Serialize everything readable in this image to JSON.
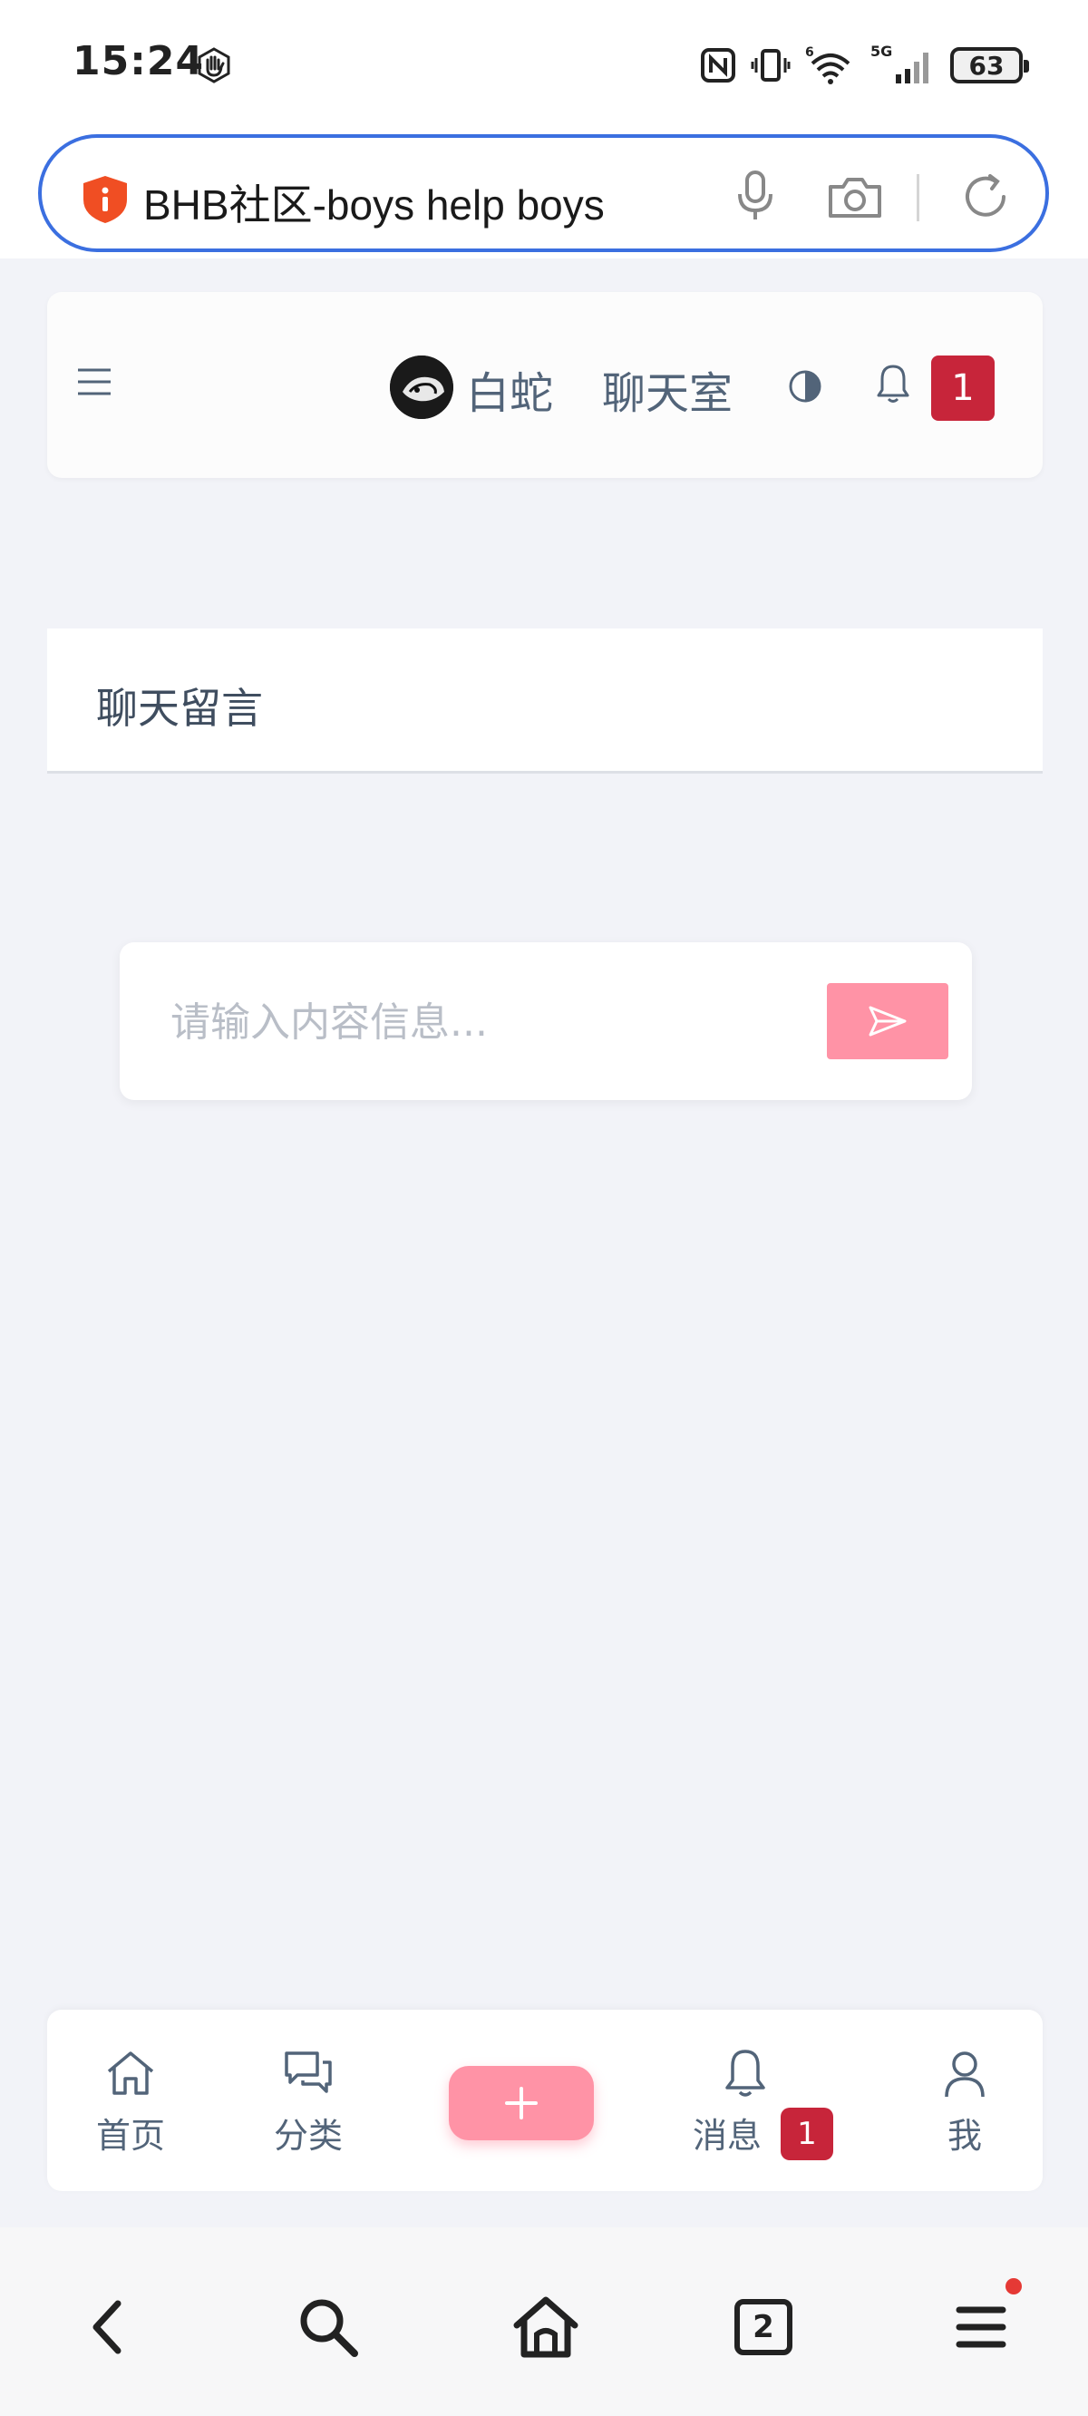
{
  "status_bar": {
    "time": "15:24",
    "battery": "63",
    "icons": [
      "hand-gesture-icon",
      "nfc-icon",
      "vibrate-icon",
      "wifi-icon",
      "signal-5g-icon",
      "battery-icon"
    ]
  },
  "browser": {
    "address_text": "BHB社区-boys help boys",
    "icons": [
      "shield-icon",
      "microphone-icon",
      "camera-icon",
      "reload-icon"
    ],
    "toolbar": {
      "tabs_count": "2",
      "icons": [
        "back-icon",
        "search-icon",
        "home-icon",
        "tabs-icon",
        "menu-icon"
      ]
    }
  },
  "header": {
    "username": "白蛇",
    "chatroom_label": "聊天室",
    "notification_count": "1",
    "icons": [
      "menu-icon",
      "theme-toggle-icon",
      "bell-icon"
    ]
  },
  "chat": {
    "title": "聊天留言",
    "input_placeholder": "请输入内容信息...",
    "input_value": "",
    "send_icon": "send-icon"
  },
  "bottom_nav": {
    "items": [
      {
        "label": "首页",
        "icon": "home-icon"
      },
      {
        "label": "分类",
        "icon": "chat-bubbles-icon"
      },
      {
        "label": "消息",
        "icon": "bell-icon",
        "badge": "1"
      },
      {
        "label": "我",
        "icon": "user-icon"
      }
    ],
    "plus_icon": "plus-icon"
  },
  "colors": {
    "accent_pink": "#ff93a6",
    "badge_red": "#c7253a",
    "text_slate": "#526479",
    "address_border": "#3b6fe0"
  }
}
